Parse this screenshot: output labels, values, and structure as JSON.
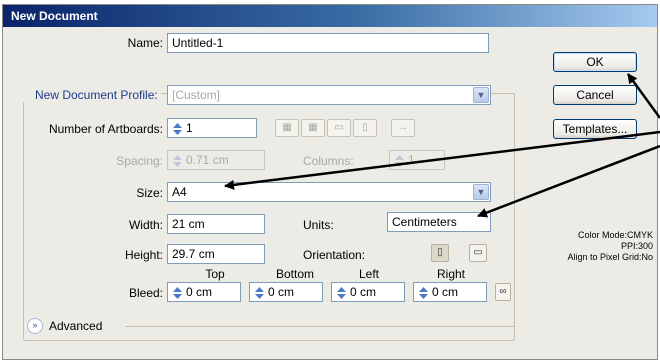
{
  "window": {
    "title": "New Document"
  },
  "fields": {
    "name_label": "Name:",
    "name_value": "Untitled-1",
    "profile_label": "New Document Profile:",
    "profile_value": "[Custom]",
    "artboards_label": "Number of Artboards:",
    "artboards_value": "1",
    "spacing_label": "Spacing:",
    "spacing_value": "0.71 cm",
    "columns_label": "Columns:",
    "columns_value": "1",
    "size_label": "Size:",
    "size_value": "A4",
    "width_label": "Width:",
    "width_value": "21 cm",
    "units_label": "Units:",
    "units_value": "Centimeters",
    "height_label": "Height:",
    "height_value": "29.7 cm",
    "orientation_label": "Orientation:",
    "bleed_label": "Bleed:",
    "bleed_top_label": "Top",
    "bleed_bottom_label": "Bottom",
    "bleed_left_label": "Left",
    "bleed_right_label": "Right",
    "bleed_top": "0 cm",
    "bleed_bottom": "0 cm",
    "bleed_left": "0 cm",
    "bleed_right": "0 cm",
    "advanced_label": "Advanced"
  },
  "buttons": {
    "ok": "OK",
    "cancel": "Cancel",
    "templates": "Templates..."
  },
  "info": {
    "color_mode": "Color Mode:CMYK",
    "ppi": "PPI:300",
    "align": "Align to Pixel Grid:No"
  },
  "colors": {
    "titlebar_start": "#0a246a",
    "titlebar_end": "#a6caf0",
    "accent": "#1f3c8c"
  }
}
